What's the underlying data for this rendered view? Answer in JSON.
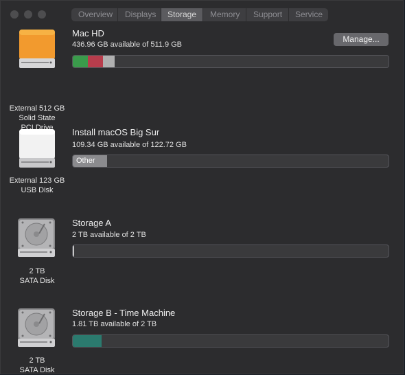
{
  "window": {
    "tabs": [
      {
        "label": "Overview",
        "active": false
      },
      {
        "label": "Displays",
        "active": false
      },
      {
        "label": "Storage",
        "active": true
      },
      {
        "label": "Memory",
        "active": false
      },
      {
        "label": "Support",
        "active": false
      },
      {
        "label": "Service",
        "active": false
      }
    ]
  },
  "devices": [
    {
      "icon": "ssd-orange-drive-icon",
      "caption_lines": [
        "External 512 GB",
        "Solid State",
        "PCI Drive"
      ],
      "volume_name": "Mac HD",
      "available_text": "436.96 GB available of 511.9 GB",
      "manage_label": "Manage...",
      "segments": [
        {
          "color": "#3a9b4b",
          "fraction": 0.048
        },
        {
          "color": "#b83d4c",
          "fraction": 0.048
        },
        {
          "color": "#b0b0b0",
          "fraction": 0.036
        }
      ]
    },
    {
      "icon": "usb-white-drive-icon",
      "caption_lines": [
        "External 123 GB",
        "USB Disk"
      ],
      "volume_name": "Install macOS Big Sur",
      "available_text": "109.34 GB available of 122.72 GB",
      "segments": [
        {
          "color": "#8b8b8e",
          "fraction": 0.109,
          "label": "Other"
        }
      ]
    },
    {
      "icon": "sata-hard-disk-icon",
      "caption_lines": [
        "2 TB",
        "SATA Disk"
      ],
      "volume_name": "Storage A",
      "available_text": "2 TB available of 2 TB",
      "segments": [
        {
          "color": "#c8c8c8",
          "fraction": 0.003
        }
      ]
    },
    {
      "icon": "sata-hard-disk-icon",
      "caption_lines": [
        "2 TB",
        "SATA Disk"
      ],
      "volume_name": "Storage B - Time Machine",
      "available_text": "1.81 TB available of 2 TB",
      "segments": [
        {
          "color": "#2b7a6e",
          "fraction": 0.092
        }
      ]
    }
  ]
}
